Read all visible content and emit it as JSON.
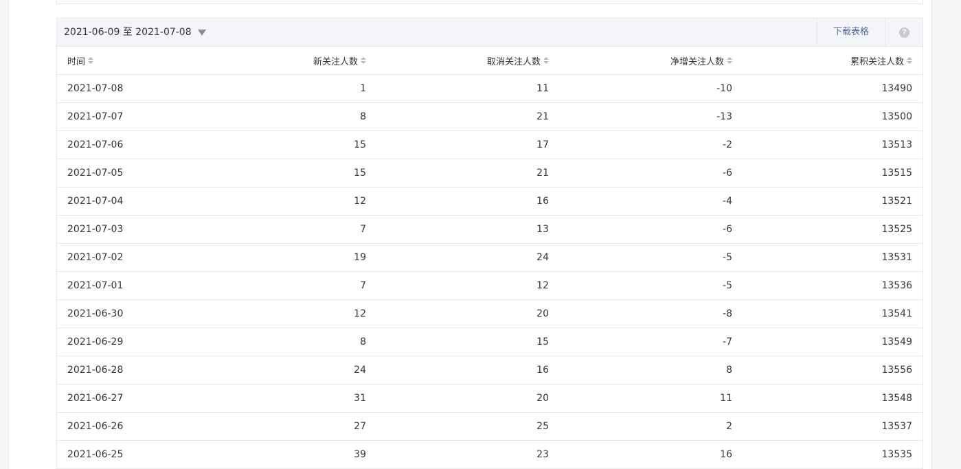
{
  "toolbar": {
    "date_range": "2021-06-09 至 2021-07-08",
    "download_label": "下载表格",
    "help_glyph": "?"
  },
  "table": {
    "columns": [
      "时间",
      "新关注人数",
      "取消关注人数",
      "净增关注人数",
      "累积关注人数"
    ],
    "rows": [
      [
        "2021-07-08",
        "1",
        "11",
        "-10",
        "13490"
      ],
      [
        "2021-07-07",
        "8",
        "21",
        "-13",
        "13500"
      ],
      [
        "2021-07-06",
        "15",
        "17",
        "-2",
        "13513"
      ],
      [
        "2021-07-05",
        "15",
        "21",
        "-6",
        "13515"
      ],
      [
        "2021-07-04",
        "12",
        "16",
        "-4",
        "13521"
      ],
      [
        "2021-07-03",
        "7",
        "13",
        "-6",
        "13525"
      ],
      [
        "2021-07-02",
        "19",
        "24",
        "-5",
        "13531"
      ],
      [
        "2021-07-01",
        "7",
        "12",
        "-5",
        "13536"
      ],
      [
        "2021-06-30",
        "12",
        "20",
        "-8",
        "13541"
      ],
      [
        "2021-06-29",
        "8",
        "15",
        "-7",
        "13549"
      ],
      [
        "2021-06-28",
        "24",
        "16",
        "8",
        "13556"
      ],
      [
        "2021-06-27",
        "31",
        "20",
        "11",
        "13548"
      ],
      [
        "2021-06-26",
        "27",
        "25",
        "2",
        "13537"
      ],
      [
        "2021-06-25",
        "39",
        "23",
        "16",
        "13535"
      ]
    ]
  },
  "colors": {
    "link": "#576b95",
    "border": "#e7e7eb",
    "toolbar_bg": "#f4f5f9",
    "text": "#353535"
  }
}
